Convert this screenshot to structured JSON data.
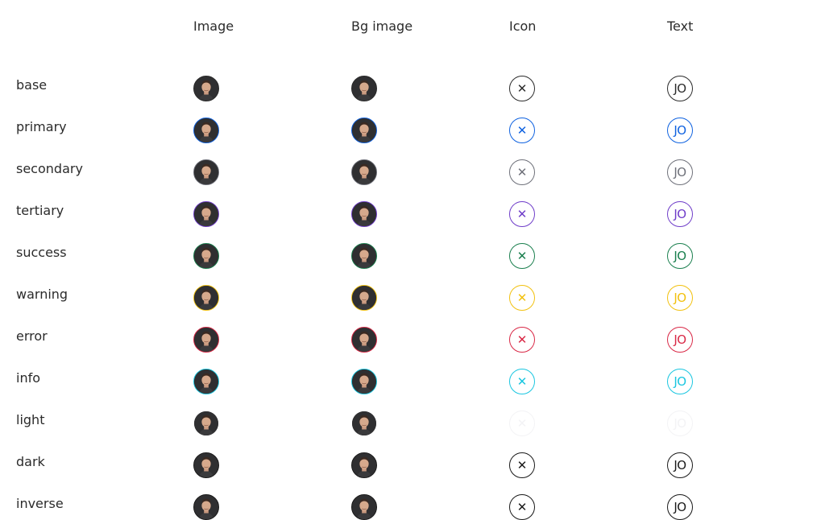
{
  "headers": [
    "",
    "Image",
    "Bg image",
    "Icon",
    "Text"
  ],
  "initials": "JO",
  "icon_symbol": "✕",
  "rows": [
    {
      "label": "base",
      "color": "#2b2b2b"
    },
    {
      "label": "primary",
      "color": "#0f62e0"
    },
    {
      "label": "secondary",
      "color": "#6e7079"
    },
    {
      "label": "tertiary",
      "color": "#6f3dc9"
    },
    {
      "label": "success",
      "color": "#1a7f4e"
    },
    {
      "label": "warning",
      "color": "#f2c10f"
    },
    {
      "label": "error",
      "color": "#d92846"
    },
    {
      "label": "info",
      "color": "#1ac6e0"
    },
    {
      "label": "light",
      "color": "#f3f3f5"
    },
    {
      "label": "dark",
      "color": "#1a1a1a"
    },
    {
      "label": "inverse",
      "color": "#1a1a1a"
    }
  ]
}
